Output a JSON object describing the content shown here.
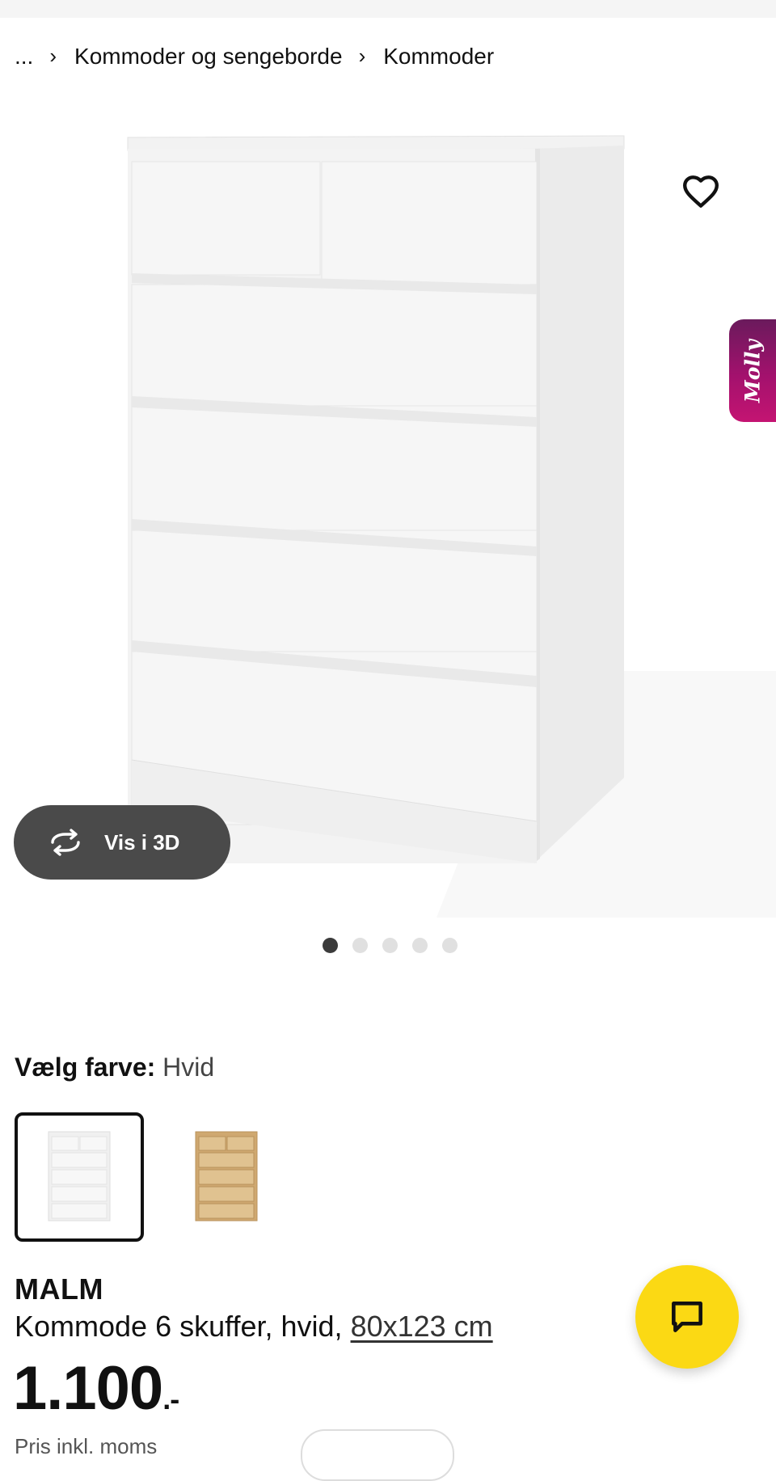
{
  "breadcrumb": {
    "ellipsis": "...",
    "separator": "›",
    "items": [
      "Kommoder og sengeborde",
      "Kommoder"
    ]
  },
  "gallery": {
    "dots_total": 5,
    "active_index": 0,
    "view3d_label": "Vis i 3D",
    "view3d_icon": "rotate-3d-icon",
    "favorite_icon": "heart-outline-icon"
  },
  "assistant": {
    "label": "Molly"
  },
  "color": {
    "label": "Vælg farve:",
    "value": "Hvid",
    "swatches": [
      {
        "name": "white",
        "selected": true,
        "hex": "#f4f4f4"
      },
      {
        "name": "oak",
        "selected": false,
        "hex": "#d9b680"
      }
    ]
  },
  "product": {
    "name": "MALM",
    "description": "Kommode 6 skuffer, hvid,",
    "size": "80x123 cm",
    "price": "1.100",
    "price_suffix": ".-",
    "price_note": "Pris inkl. moms"
  },
  "colors": {
    "accent_yellow": "#fbd914",
    "button_dark": "#4a4a4a",
    "molly_gradient_start": "#6a1a5c",
    "molly_gradient_end": "#c41472"
  },
  "chat_icon": "chat-bubble-icon"
}
